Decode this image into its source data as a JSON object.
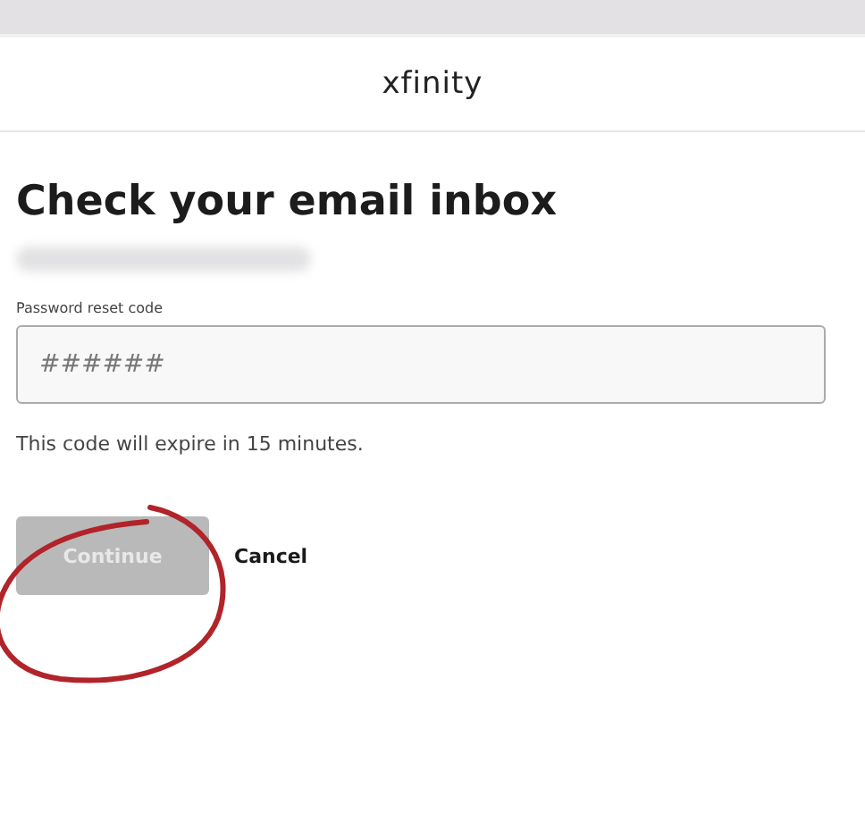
{
  "header": {
    "logo": "xfinity"
  },
  "title": "Check your email inbox",
  "code_field": {
    "label": "Password reset code",
    "placeholder": "######"
  },
  "hint": "This code will expire in 15 minutes.",
  "buttons": [
    {
      "kind": "primary",
      "label": "Continue",
      "disabled": true
    },
    {
      "kind": "link",
      "label": "Cancel",
      "disabled": false
    }
  ]
}
